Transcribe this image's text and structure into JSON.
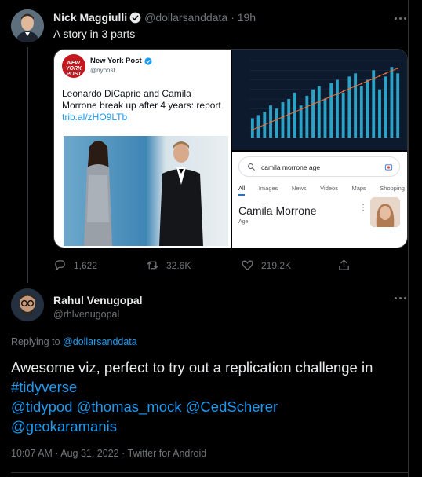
{
  "tweet1": {
    "name": "Nick Maggiulli",
    "handle": "@dollarsanddata",
    "time": "· 19h",
    "text": "A story in 3 parts",
    "quoted": {
      "logo_text": "NEW YORK POST",
      "name": "New York Post",
      "handle": "@nypost",
      "text": "Leonardo DiCaprio and Camila Morrone break up after 4 years: report",
      "link": "trib.al/zHO9LTb"
    },
    "chart_panel": {
      "bar_values": [
        6,
        7,
        8,
        10,
        9,
        11,
        12,
        14,
        10,
        13,
        15,
        16,
        12,
        17,
        18,
        14,
        19,
        20,
        16,
        18,
        21,
        15,
        19,
        22,
        20
      ]
    },
    "google": {
      "query": "camila morrone age",
      "tabs": [
        "All",
        "Images",
        "News",
        "Videos",
        "Maps",
        "Shopping"
      ],
      "result_title": "Camila Morrone",
      "result_sub": "Age"
    },
    "stats": {
      "replies": "1,622",
      "retweets": "32.6K",
      "likes": "219.2K"
    }
  },
  "tweet2": {
    "name": "Rahul Venugopal",
    "handle": "@rhlvenugopal",
    "replying_label": "Replying to",
    "replying_to": "@dollarsanddata",
    "body_plain": "Awesome viz, perfect to try out a replication challenge in",
    "hashtag": "#tidyverse",
    "mention1": "@tidypod",
    "mention2": "@thomas_mock",
    "mention3": "@CedScherer",
    "mention4": "@geokaramanis",
    "meta": "10:07 AM · Aug 31, 2022 · Twitter for Android"
  },
  "colors": {
    "background": "#000000",
    "link": "#1d9bf0",
    "muted": "#71767b",
    "text": "#e7e9ea"
  },
  "icons": [
    "verified-badge-icon",
    "more-icon",
    "reply-icon",
    "retweet-icon",
    "like-icon",
    "share-icon",
    "search-icon",
    "camera-icon"
  ]
}
